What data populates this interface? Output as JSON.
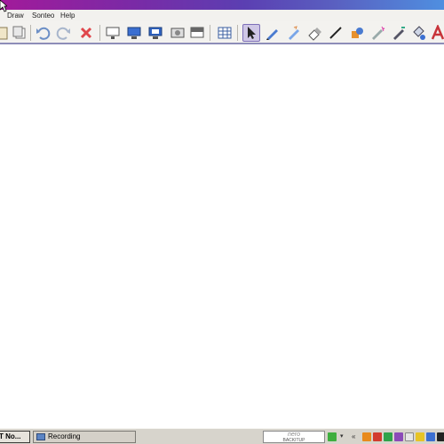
{
  "menu": {
    "items": [
      "Draw",
      "Sonteo",
      "Help"
    ]
  },
  "toolbar": {
    "selected_tool": "pointer-tool",
    "accent": "#7d6fb8"
  },
  "taskbar": {
    "tasks": [
      "T No...",
      "Recording"
    ],
    "nero_label": "nero",
    "nero_sub": "BACKITUP"
  },
  "colors": {
    "title_gradient_start": "#a21a9a",
    "title_gradient_end": "#4f8fe0"
  }
}
